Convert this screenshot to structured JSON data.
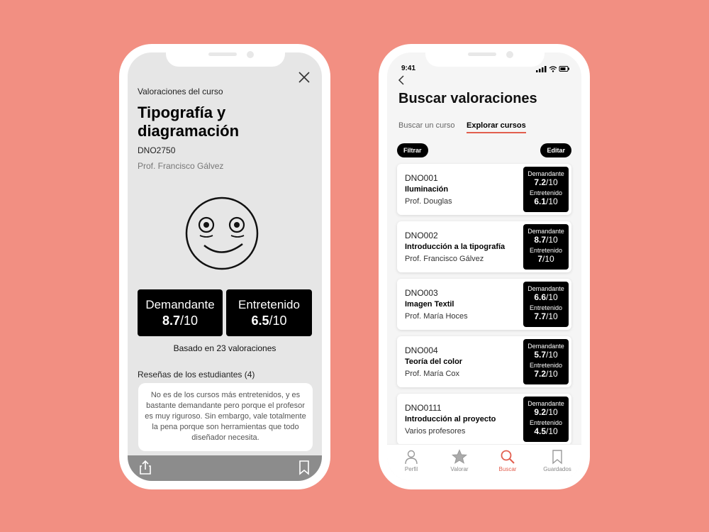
{
  "left": {
    "section_label": "Valoraciones del curso",
    "course_title": "Tipografía y diagramación",
    "course_code": "DNO2750",
    "professor": "Prof. Francisco Gálvez",
    "scores": {
      "demanding_label": "Demandante",
      "demanding_value": "8.7",
      "entertaining_label": "Entretenido",
      "entertaining_value": "6.5",
      "scale": "/10"
    },
    "based_on": "Basado en 23 valoraciones",
    "reviews_title": "Reseñas de los estudiantes (4)",
    "review_text": "No es de los cursos más entretenidos, y es bastante demandante pero porque el profesor es muy riguroso. Sin embargo, vale totalmente la pena porque son herramientas que todo diseñador necesita."
  },
  "right": {
    "status_time": "9:41",
    "title": "Buscar valoraciones",
    "tabs": {
      "search": "Buscar un curso",
      "explore": "Explorar cursos"
    },
    "filter_label": "Filtrar",
    "edit_label": "Editar",
    "badge_labels": {
      "demanding": "Demandante",
      "entertaining": "Entretenido",
      "scale": "/10"
    },
    "courses": [
      {
        "code": "DNO001",
        "name": "Iluminación",
        "professor": "Prof. Douglas",
        "demanding": "7.2",
        "entertaining": "6.1"
      },
      {
        "code": "DNO002",
        "name": "Introducción a la tipografía",
        "professor": "Prof. Francisco Gálvez",
        "demanding": "8.7",
        "entertaining": "7"
      },
      {
        "code": "DNO003",
        "name": "Imagen Textil",
        "professor": "Prof. María Hoces",
        "demanding": "6.6",
        "entertaining": "7.7"
      },
      {
        "code": "DNO004",
        "name": "Teoría del color",
        "professor": "Prof. María Cox",
        "demanding": "5.7",
        "entertaining": "7.2"
      },
      {
        "code": "DNO0111",
        "name": "Introducción al proyecto",
        "professor": "Varios profesores",
        "demanding": "9.2",
        "entertaining": "4.5"
      }
    ],
    "nav": {
      "profile": "Perfil",
      "rate": "Valorar",
      "search": "Buscar",
      "saved": "Guardados"
    }
  },
  "colors": {
    "background": "#f28f82",
    "accent": "#e25e4e"
  }
}
